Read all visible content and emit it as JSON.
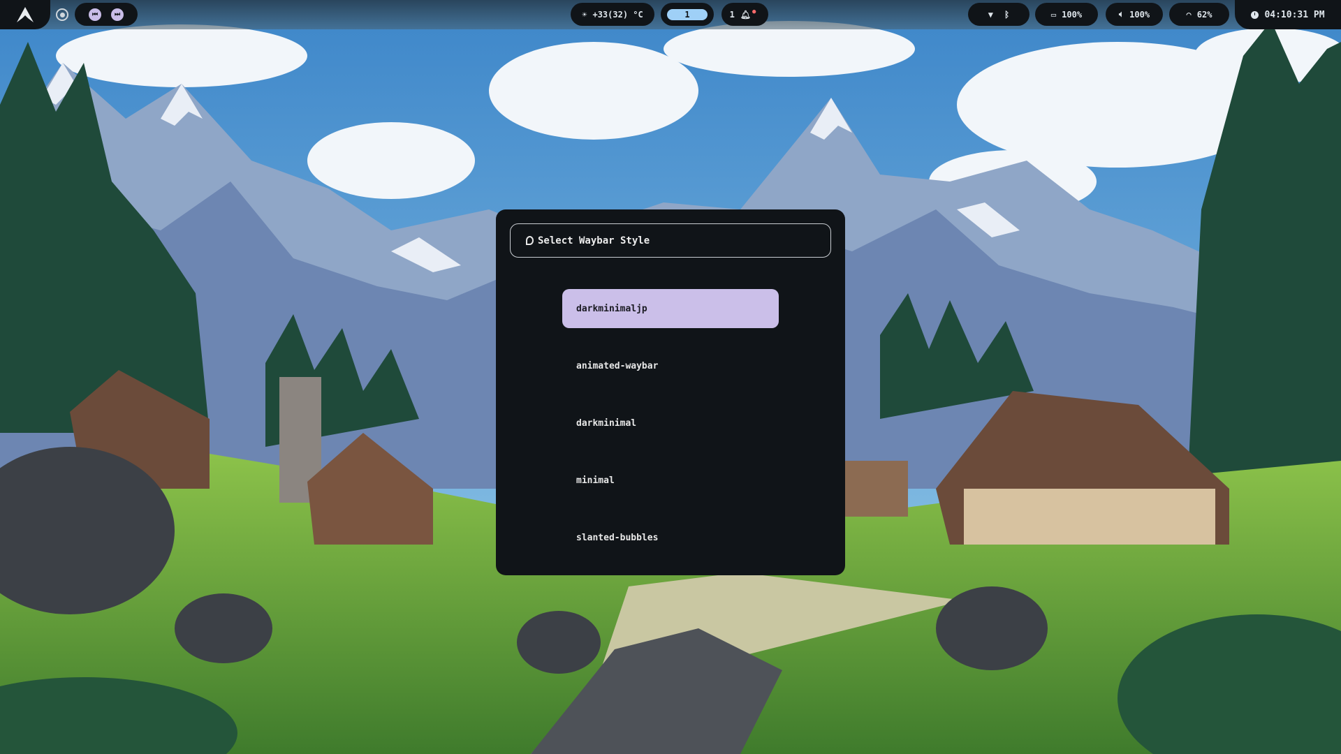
{
  "topbar": {
    "left": {
      "logo_icon": "arch-logo-icon",
      "record_icon": "record-circle-icon",
      "media_prev_icon": "skip-previous-icon",
      "media_next_icon": "skip-next-icon"
    },
    "weather": {
      "icon": "sun-icon",
      "text": "+33(32) °C"
    },
    "workspace": {
      "active": "1"
    },
    "notifications": {
      "count": "1",
      "icon": "bell-icon"
    },
    "connectivity": {
      "wifi_icon": "network-icon",
      "bluetooth_icon": "bluetooth-icon"
    },
    "memory": {
      "icon": "memory-icon",
      "value": "100%"
    },
    "volume": {
      "icon": "volume-icon",
      "value": "100%"
    },
    "wifi": {
      "icon": "wifi-icon",
      "value": "62%"
    },
    "clock": {
      "icon": "clock-icon",
      "time": "04:10:31 PM"
    }
  },
  "launcher": {
    "prompt": "Select Waybar Style",
    "items": [
      {
        "label": "darkminimaljp",
        "selected": true
      },
      {
        "label": "animated-waybar",
        "selected": false
      },
      {
        "label": "darkminimal",
        "selected": false
      },
      {
        "label": "minimal",
        "selected": false
      },
      {
        "label": "slanted-bubbles",
        "selected": false
      }
    ]
  },
  "colors": {
    "panel_bg": "#101418",
    "selection": "#cbbfe9",
    "workspace_active": "#9fd0f7",
    "notification_accent": "#ff6b6b"
  }
}
